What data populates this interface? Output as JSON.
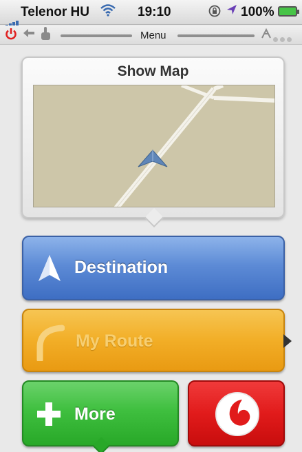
{
  "statusbar": {
    "carrier": "Telenor HU",
    "time": "19:10",
    "battery_percent": "100%",
    "icons": [
      "signal-icon",
      "wifi-icon",
      "rotation-lock-icon",
      "location-arrow-icon",
      "battery-icon"
    ]
  },
  "toolbar": {
    "title": "Menu",
    "icons": [
      "power-icon",
      "back-arrow-icon",
      "hand-icon",
      "gps-icon",
      "page-dots-icon"
    ]
  },
  "map_panel": {
    "title": "Show Map"
  },
  "buttons": {
    "destination": "Destination",
    "my_route": "My Route",
    "more": "More",
    "vodafone_icon": "vodafone-logo-icon"
  },
  "colors": {
    "destination": "#5d8bd6",
    "my_route": "#f2ae27",
    "more": "#3fbf3f",
    "vodafone": "#e11b1b",
    "power": "#e02020",
    "map_bg": "#cdc6a9"
  }
}
